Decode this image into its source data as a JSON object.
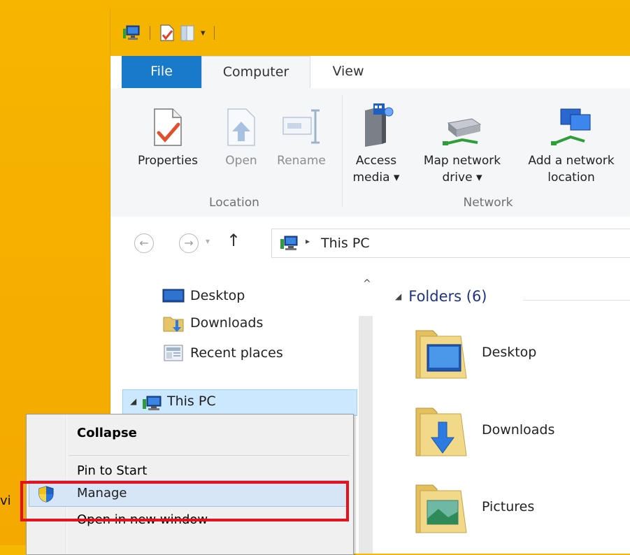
{
  "quick_access": {
    "dropdown_glyph": "▾"
  },
  "tabs": [
    {
      "label": "File"
    },
    {
      "label": "Computer"
    },
    {
      "label": "View"
    }
  ],
  "ribbon": {
    "location": {
      "group_label": "Location",
      "buttons": [
        {
          "label": "Properties",
          "icon": "properties-icon"
        },
        {
          "label": "Open",
          "icon": "open-icon"
        },
        {
          "label": "Rename",
          "icon": "rename-icon"
        }
      ]
    },
    "network": {
      "group_label": "Network",
      "buttons": [
        {
          "line1": "Access",
          "line2": "media ▾",
          "icon": "access-media-icon"
        },
        {
          "line1": "Map network",
          "line2": "drive ▾",
          "icon": "map-network-drive-icon"
        },
        {
          "line1": "Add a network",
          "line2": "location",
          "icon": "add-network-location-icon"
        }
      ]
    }
  },
  "navigation": {
    "back_glyph": "←",
    "forward_glyph": "→",
    "recent_glyph": "▾",
    "up_glyph": "↑",
    "breadcrumb_separator": "▸",
    "breadcrumb": "This PC"
  },
  "nav_pane": {
    "items": [
      {
        "label": "Desktop",
        "icon": "desktop-icon"
      },
      {
        "label": "Downloads",
        "icon": "downloads-folder-icon"
      },
      {
        "label": "Recent places",
        "icon": "recent-places-icon"
      }
    ],
    "this_pc": {
      "label": "This PC",
      "expander": "◢"
    },
    "scroll_up_glyph": "^"
  },
  "content": {
    "section_title": "Folders (6)",
    "section_expander": "◢",
    "folders": [
      {
        "label": "Desktop"
      },
      {
        "label": "Downloads"
      },
      {
        "label": "Pictures"
      }
    ]
  },
  "context_menu": {
    "items": [
      {
        "label": "Collapse",
        "bold": true
      },
      {
        "label": "Pin to Start"
      },
      {
        "label": "Manage",
        "highlighted": true,
        "icon": "uac-shield-icon"
      },
      {
        "label": "Open in new window"
      }
    ],
    "annotation_color": "#e8101a"
  },
  "left_stub_text": "vi",
  "colors": {
    "desktop_background": "#f6b800",
    "file_tab": "#1979ca",
    "selection": "#cce8ff",
    "section_title": "#1e3287"
  }
}
